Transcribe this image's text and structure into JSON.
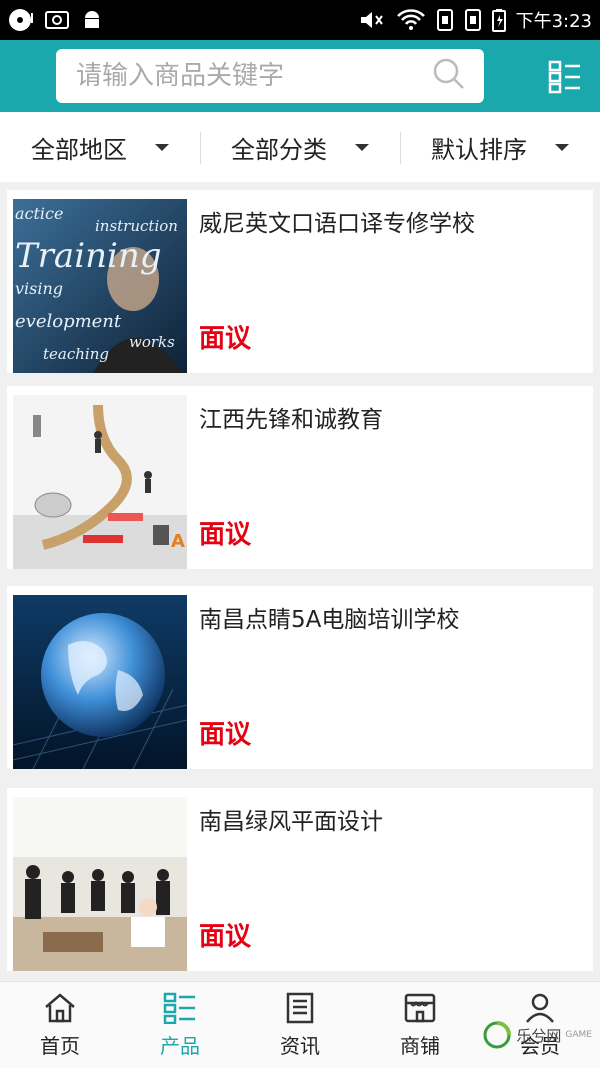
{
  "status_bar": {
    "time": "下午3:23"
  },
  "search": {
    "placeholder": "请输入商品关键字"
  },
  "filters": [
    {
      "label": "全部地区"
    },
    {
      "label": "全部分类"
    },
    {
      "label": "默认排序"
    }
  ],
  "products": [
    {
      "title": "威尼英文口语口译专修学校",
      "price": "面议",
      "image": "training-board-photo"
    },
    {
      "title": "江西先锋和诚教育",
      "price": "面议",
      "image": "staircase-business-photo"
    },
    {
      "title": "南昌点睛5A电脑培训学校",
      "price": "面议",
      "image": "globe-keyboard-photo"
    },
    {
      "title": "南昌绿风平面设计",
      "price": "面议",
      "image": "office-team-photo"
    }
  ],
  "nav": [
    {
      "label": "首页",
      "icon": "home-icon",
      "active": false
    },
    {
      "label": "产品",
      "icon": "product-list-icon",
      "active": true
    },
    {
      "label": "资讯",
      "icon": "news-icon",
      "active": false
    },
    {
      "label": "商铺",
      "icon": "shop-icon",
      "active": false
    },
    {
      "label": "会员",
      "icon": "user-icon",
      "active": false
    }
  ],
  "watermark": {
    "text": "乐兮网",
    "sub": "GAME"
  },
  "colors": {
    "accent": "#1aa8ac",
    "price": "#e60012"
  }
}
